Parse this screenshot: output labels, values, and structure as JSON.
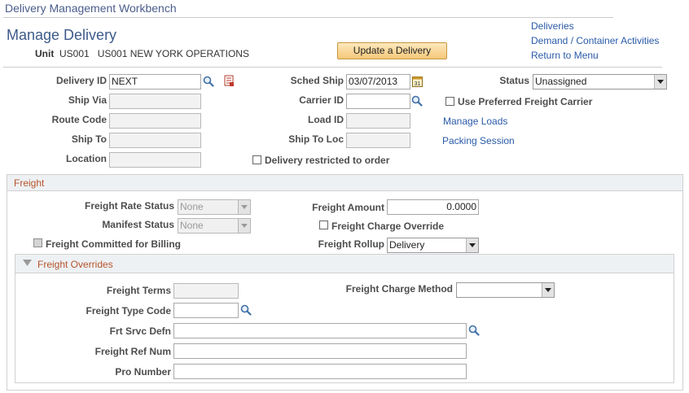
{
  "app": {
    "title": "Delivery Management Workbench"
  },
  "page": {
    "title": "Manage Delivery",
    "unit_label": "Unit",
    "unit_value": "US001   US001 NEW YORK OPERATIONS",
    "update_button": "Update a Delivery"
  },
  "nav_links": {
    "deliveries": "Deliveries",
    "demand": "Demand / Container Activities",
    "return": "Return to Menu"
  },
  "header_fields": {
    "delivery_id": {
      "label": "Delivery ID",
      "value": "NEXT"
    },
    "ship_via": {
      "label": "Ship Via",
      "value": ""
    },
    "route_code": {
      "label": "Route Code",
      "value": ""
    },
    "ship_to": {
      "label": "Ship To",
      "value": ""
    },
    "location": {
      "label": "Location",
      "value": ""
    },
    "sched_ship": {
      "label": "Sched Ship",
      "value": "03/07/2013"
    },
    "carrier_id": {
      "label": "Carrier ID",
      "value": ""
    },
    "load_id": {
      "label": "Load ID",
      "value": ""
    },
    "ship_to_loc": {
      "label": "Ship To Loc",
      "value": ""
    },
    "status": {
      "label": "Status",
      "value": "Unassigned"
    },
    "use_preferred_carrier": {
      "label": "Use Preferred Freight Carrier",
      "checked": false
    },
    "delivery_restricted": {
      "label": "Delivery restricted to order",
      "checked": false
    },
    "manage_loads_link": "Manage Loads",
    "packing_session_link": "Packing Session"
  },
  "freight": {
    "section_title": "Freight",
    "rate_status": {
      "label": "Freight Rate Status",
      "value": "None"
    },
    "manifest_status": {
      "label": "Manifest Status",
      "value": "None"
    },
    "committed_billing": {
      "label": "Freight Committed for Billing",
      "checked": false
    },
    "amount": {
      "label": "Freight Amount",
      "value": "0.0000"
    },
    "charge_override": {
      "label": "Freight Charge Override",
      "checked": false
    },
    "rollup": {
      "label": "Freight Rollup",
      "value": "Delivery"
    }
  },
  "freight_overrides": {
    "section_title": "Freight Overrides",
    "terms": {
      "label": "Freight Terms",
      "value": ""
    },
    "type_code": {
      "label": "Freight Type Code",
      "value": ""
    },
    "srvc_defn": {
      "label": "Frt Srvc Defn",
      "value": ""
    },
    "ref_num": {
      "label": "Freight Ref Num",
      "value": ""
    },
    "pro_number": {
      "label": "Pro Number",
      "value": ""
    },
    "charge_method": {
      "label": "Freight Charge Method",
      "value": ""
    }
  },
  "icons": {
    "lookup": "magnifier-icon",
    "detail": "document-detail-icon",
    "calendar": "calendar-icon",
    "collapse": "triangle-down-icon"
  }
}
